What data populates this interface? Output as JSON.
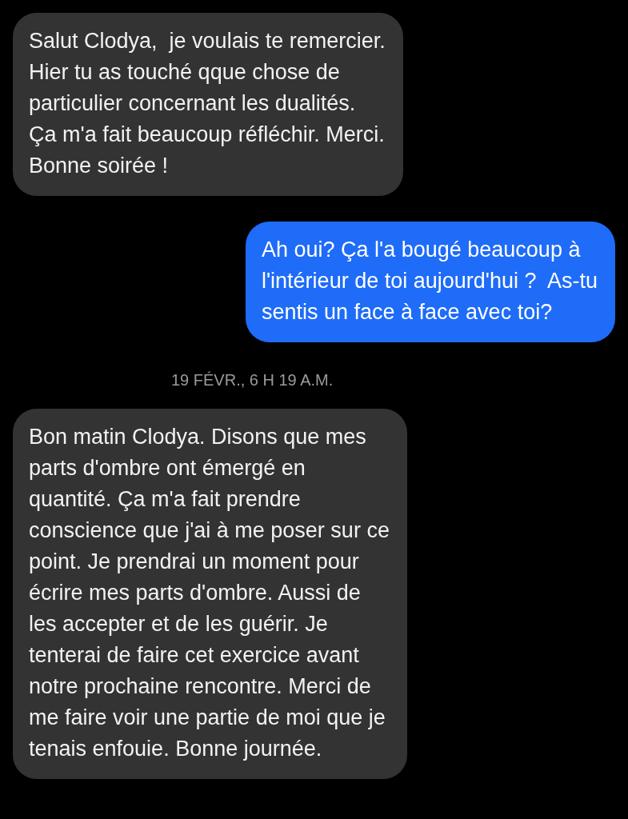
{
  "messages": [
    {
      "kind": "received",
      "text": "Salut Clodya,  je voulais te remercier.\nHier tu as touché qque chose de\nparticulier concernant les dualités.\nÇa m'a fait beaucoup réfléchir. Merci.\nBonne soirée !"
    },
    {
      "kind": "sent",
      "text": "Ah oui? Ça l'a bougé beaucoup à\nl'intérieur de toi aujourd'hui ?  As-tu\nsentis un face à face avec toi?"
    },
    {
      "kind": "timestamp",
      "text": "19 FÉVR., 6 H 19 A.M."
    },
    {
      "kind": "received",
      "text": "Bon matin Clodya. Disons que mes\nparts d'ombre ont émergé en\nquantité. Ça m'a fait prendre\nconscience que j'ai à me poser sur ce\npoint. Je prendrai un moment pour\nécrire mes parts d'ombre. Aussi de\nles accepter et de les guérir. Je\ntenterai de faire cet exercice avant\nnotre prochaine rencontre. Merci de\nme faire voir une partie de moi que je\ntenais enfouie. Bonne journée."
    }
  ]
}
